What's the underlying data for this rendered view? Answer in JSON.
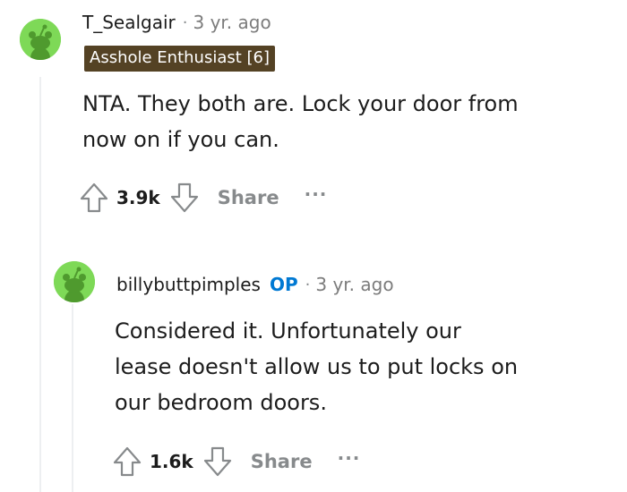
{
  "comments": [
    {
      "username": "T_Sealgair",
      "separator": "·",
      "time": "3 yr. ago",
      "flair": "Asshole Enthusiast [6]",
      "body_lines": [
        "NTA. They both are. Lock your door from",
        "now on if you can."
      ],
      "score": "3.9k",
      "share_label": "Share",
      "more_label": "···",
      "avatar_color": "#7ed957"
    },
    {
      "username": "billybuttpimples",
      "op_badge": "OP",
      "separator": "·",
      "time": "3 yr. ago",
      "body_lines": [
        "Considered it. Unfortunately our",
        "lease doesn't allow us to put locks on",
        "our bedroom doors."
      ],
      "score": "1.6k",
      "share_label": "Share",
      "more_label": "···",
      "avatar_color": "#7ed957"
    }
  ],
  "colors": {
    "flair_bg": "#544224",
    "op_blue": "#0079d3",
    "muted": "#878a8c",
    "thread_line": "#edeff1"
  },
  "icons": [
    "reddit-avatar-icon",
    "upvote-arrow-icon",
    "downvote-arrow-icon"
  ]
}
